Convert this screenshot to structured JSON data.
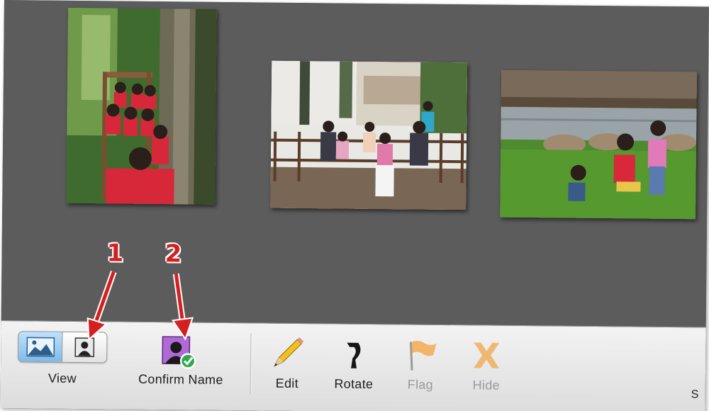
{
  "viewer": {
    "photos": [
      {
        "icon": "photo-children-on-stairs"
      },
      {
        "icon": "photo-family-on-deck"
      },
      {
        "icon": "photo-kids-on-grass"
      }
    ]
  },
  "annotations": {
    "marker_1": "1",
    "marker_2": "2",
    "color": "#d42020"
  },
  "toolbar": {
    "view_label": "View",
    "view_options": [
      {
        "icon": "landscape-photo-icon",
        "active": true
      },
      {
        "icon": "face-portrait-icon",
        "active": false
      }
    ],
    "confirm_name_label": "Confirm Name",
    "edit_label": "Edit",
    "rotate_label": "Rotate",
    "flag_label": "Flag",
    "hide_label": "Hide",
    "edge_text": "S"
  },
  "colors": {
    "viewer_background": "#5c5c5c",
    "toolbar_background": "#e6e6e6",
    "active_segment": "#9fcdf5",
    "disabled_label": "#9a9a9a"
  }
}
